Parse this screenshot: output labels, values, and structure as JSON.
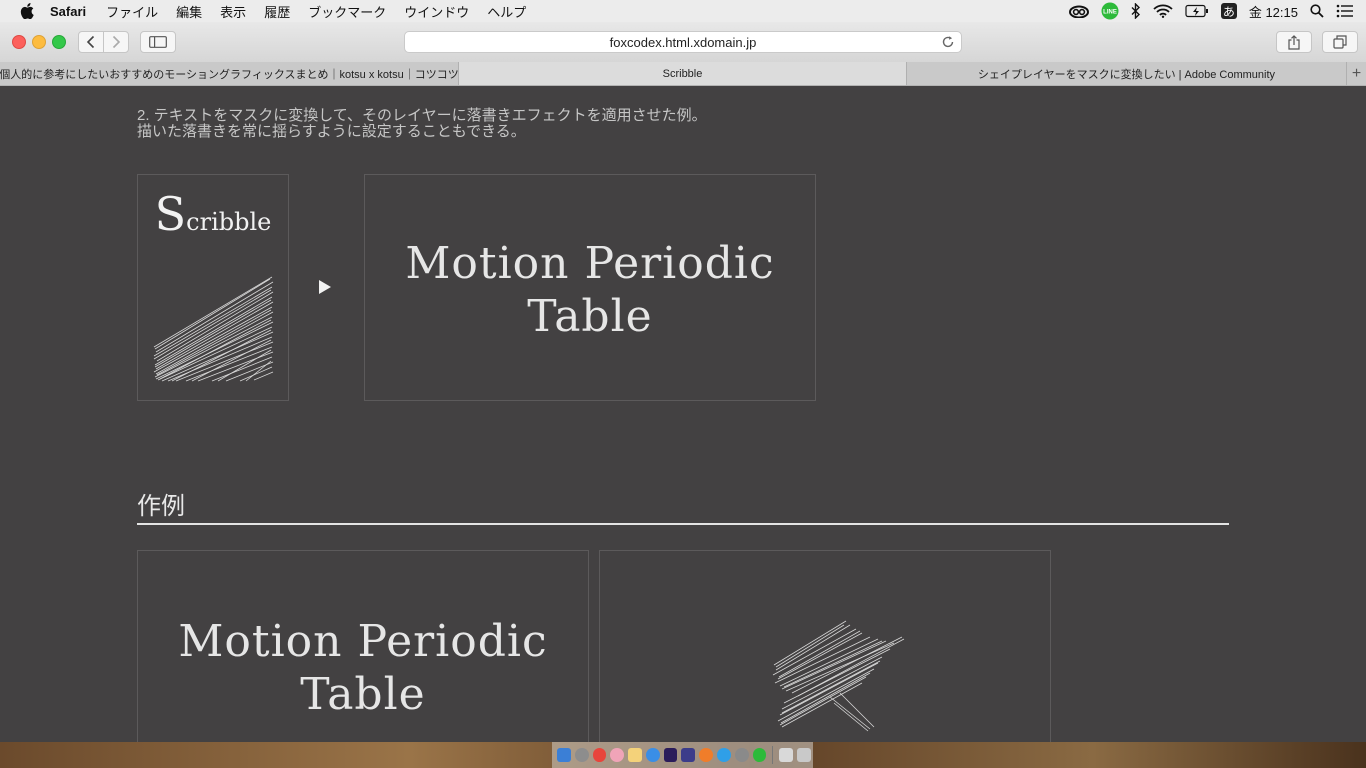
{
  "menubar": {
    "app_name": "Safari",
    "items": [
      "ファイル",
      "編集",
      "表示",
      "履歴",
      "ブックマーク",
      "ウインドウ",
      "ヘルプ"
    ],
    "status": {
      "line_icon_label": "LINE",
      "input_method": "あ",
      "clock": "金 12:15"
    }
  },
  "browser": {
    "url": "foxcodex.html.xdomain.jp",
    "tabs": [
      {
        "title": "個人的に参考にしたいおすすめのモーショングラフィックスまとめ｜kotsu x kotsu｜コツコツ"
      },
      {
        "title": "Scribble"
      },
      {
        "title": "シェイプレイヤーをマスクに変換したい | Adobe Community"
      }
    ],
    "new_tab_label": "+"
  },
  "page": {
    "desc_line1": "2. テキストをマスクに変換して、そのレイヤーに落書きエフェクトを適用させた例。",
    "desc_line2": "描いた落書きを常に揺らすように設定することもできる。",
    "example_before": {
      "title_big": "S",
      "title_rest": "cribble"
    },
    "example_after": {
      "line1": "Motion Periodic",
      "line2": "Table"
    },
    "section_heading": "作例",
    "gallery": [
      {
        "line1": "Motion Periodic",
        "line2": "Table"
      },
      {
        "shape": "scribble-star"
      }
    ]
  },
  "colors": {
    "page_bg": "#434142",
    "box_border": "#5c5a5b",
    "chalk_text": "#e6e6e6"
  }
}
